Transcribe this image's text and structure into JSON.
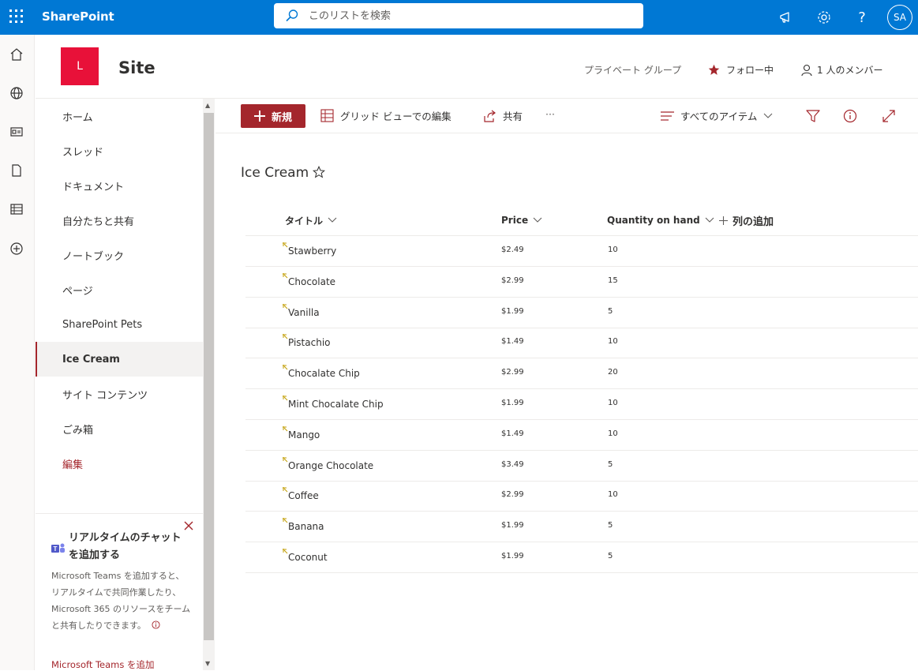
{
  "topbar": {
    "brand": "SharePoint",
    "search_placeholder": "このリストを検索",
    "avatar_initials": "SA",
    "icons": [
      "app-launcher-icon",
      "megaphone-icon",
      "gear-icon",
      "help-icon"
    ]
  },
  "rail": {
    "icons": [
      "home-icon",
      "globe-icon",
      "news-icon",
      "document-icon",
      "list-icon",
      "add-circle-icon"
    ]
  },
  "site": {
    "logo_letter": "L",
    "title": "Site",
    "privacy": "プライベート グループ",
    "follow": "フォロー中",
    "members": "1 人のメンバー"
  },
  "nav": {
    "items": [
      {
        "label": "ホーム"
      },
      {
        "label": "スレッド"
      },
      {
        "label": "ドキュメント"
      },
      {
        "label": "自分たちと共有"
      },
      {
        "label": "ノートブック"
      },
      {
        "label": "ページ"
      },
      {
        "label": "SharePoint Pets"
      },
      {
        "label": "Ice Cream"
      },
      {
        "label": "サイト コンテンツ"
      },
      {
        "label": "ごみ箱"
      },
      {
        "label": "編集"
      }
    ],
    "active_index": 7
  },
  "teams_card": {
    "title": "リアルタイムのチャットを追加する",
    "body": "Microsoft Teams を追加すると、リアルタイムで共同作業したり、Microsoft 365 のリソースをチームと共有したりできます。",
    "link": "Microsoft Teams を追加"
  },
  "cmdbar": {
    "new_label": "新規",
    "grid_edit_label": "グリッド ビューでの編集",
    "share_label": "共有",
    "more_label": "···",
    "view_label": "すべてのアイテム"
  },
  "list": {
    "title": "Ice Cream",
    "columns": {
      "title": "タイトル",
      "price": "Price",
      "quantity": "Quantity on hand",
      "add_column": "列の追加"
    },
    "rows": [
      {
        "title": "Stawberry",
        "price": "$2.49",
        "qty": "10"
      },
      {
        "title": "Chocolate",
        "price": "$2.99",
        "qty": "15"
      },
      {
        "title": "Vanilla",
        "price": "$1.99",
        "qty": "5"
      },
      {
        "title": "Pistachio",
        "price": "$1.49",
        "qty": "10"
      },
      {
        "title": "Chocalate Chip",
        "price": "$2.99",
        "qty": "20"
      },
      {
        "title": "Mint Chocalate Chip",
        "price": "$1.99",
        "qty": "10"
      },
      {
        "title": "Mango",
        "price": "$1.49",
        "qty": "10"
      },
      {
        "title": "Orange Chocolate",
        "price": "$3.49",
        "qty": "5"
      },
      {
        "title": "Coffee",
        "price": "$2.99",
        "qty": "10"
      },
      {
        "title": "Banana",
        "price": "$1.99",
        "qty": "5"
      },
      {
        "title": "Coconut",
        "price": "$1.99",
        "qty": "5"
      }
    ]
  },
  "colors": {
    "suite_bar": "#0078d4",
    "accent": "#a4262c",
    "site_logo": "#e81139"
  }
}
